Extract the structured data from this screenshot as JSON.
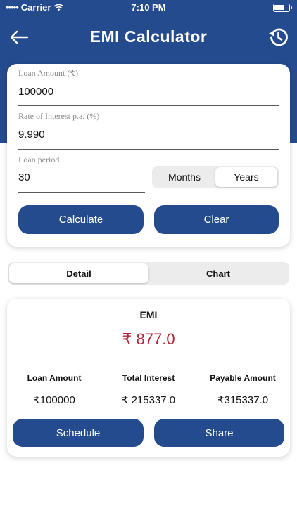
{
  "status_bar": {
    "carrier": "Carrier",
    "time": "7:10 PM"
  },
  "navbar": {
    "title": "EMI Calculator",
    "back_icon": "arrow-left-icon",
    "history_icon": "history-icon"
  },
  "form": {
    "loan_amount_label": "Loan Amount (₹)",
    "loan_amount_value": "100000",
    "interest_label": "Rate of Interest p.a. (%)",
    "interest_value": "9.990",
    "period_label": "Loan period",
    "period_value": "30",
    "period_units": [
      "Months",
      "Years"
    ],
    "period_selected": "Years",
    "calculate_label": "Calculate",
    "clear_label": "Clear"
  },
  "view_tabs": {
    "detail": "Detail",
    "chart": "Chart",
    "selected": "Detail"
  },
  "result": {
    "emi_label": "EMI",
    "emi_value": "₹ 877.0",
    "loan_amount_label": "Loan Amount",
    "loan_amount_value": "₹100000",
    "total_interest_label": "Total Interest",
    "total_interest_value": "₹ 215337.0",
    "payable_label": "Payable Amount",
    "payable_value": "₹315337.0",
    "schedule_label": "Schedule",
    "share_label": "Share"
  },
  "colors": {
    "primary": "#244b8d",
    "emi_value": "#b3263a",
    "background": "#ffffff"
  }
}
